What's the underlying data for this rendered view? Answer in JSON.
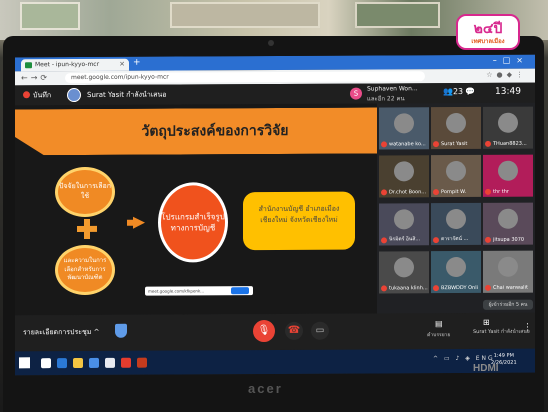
{
  "logo": {
    "text": "๒๔ปี",
    "sub": "เทศบาลเมือง"
  },
  "browser": {
    "tab_title": "Meet - ipun-kyyo-mcr",
    "url": "meet.google.com/ipun-kyyo-mcr"
  },
  "meet": {
    "rec_label": "บันทึก",
    "presenter": "Surat Yasit กำลังนำเสนอ",
    "speaker_initial": "S",
    "speaker_name": "Suphaven Won...",
    "speaker_sub": "และอีก 22 คน",
    "people_count": "23",
    "clock": "13:49"
  },
  "slide": {
    "title": "วัตถุประสงค์ของการวิจัย",
    "circle1": "ปัจจัยในการเลือกใช้",
    "circle2": "และความในการเลือกสำหรับการพัฒนาบัณฑิต",
    "circle3": "โปรแกรมสำเร็จรูปทางการบัญชี",
    "yellow": "สำนักงานบัญชี อำเภอเมืองเชียงใหม่ จังหวัดเชียงใหม่",
    "link": "meet.google.com/kfkpenk..."
  },
  "participants": [
    {
      "name": "watanabe ko..."
    },
    {
      "name": "Surat Yasit"
    },
    {
      "name": "THuan8823..."
    },
    {
      "name": "Dr.chot Boon..."
    },
    {
      "name": "Pornpit W."
    },
    {
      "name": "thr thr"
    },
    {
      "name": "นิรมิตร์ อินสิ..."
    },
    {
      "name": "ดารารัตน์ ..."
    },
    {
      "name": "jitsupa 3070"
    },
    {
      "name": "tukaana klinh..."
    },
    {
      "name": "BZBWDDY Onli"
    },
    {
      "name": "Chai wanwalit"
    }
  ],
  "more_label": "ผู้เข้าร่วมอีก 5 คน",
  "bottom": {
    "meeting_details": "รายละเอียดการประชุม",
    "captions_label": "คำบรรยาย",
    "present_label": "Surat Yasit กำลังนำเสนอ"
  },
  "taskbar": {
    "time": "1:49 PM",
    "date": "2/26/2021"
  },
  "brand": "acer",
  "hdmi": "HDMI",
  "colors": {
    "accent_orange": "#f08a24",
    "mic_red": "#ea4335",
    "chrome_blue": "#2b6fd1"
  }
}
